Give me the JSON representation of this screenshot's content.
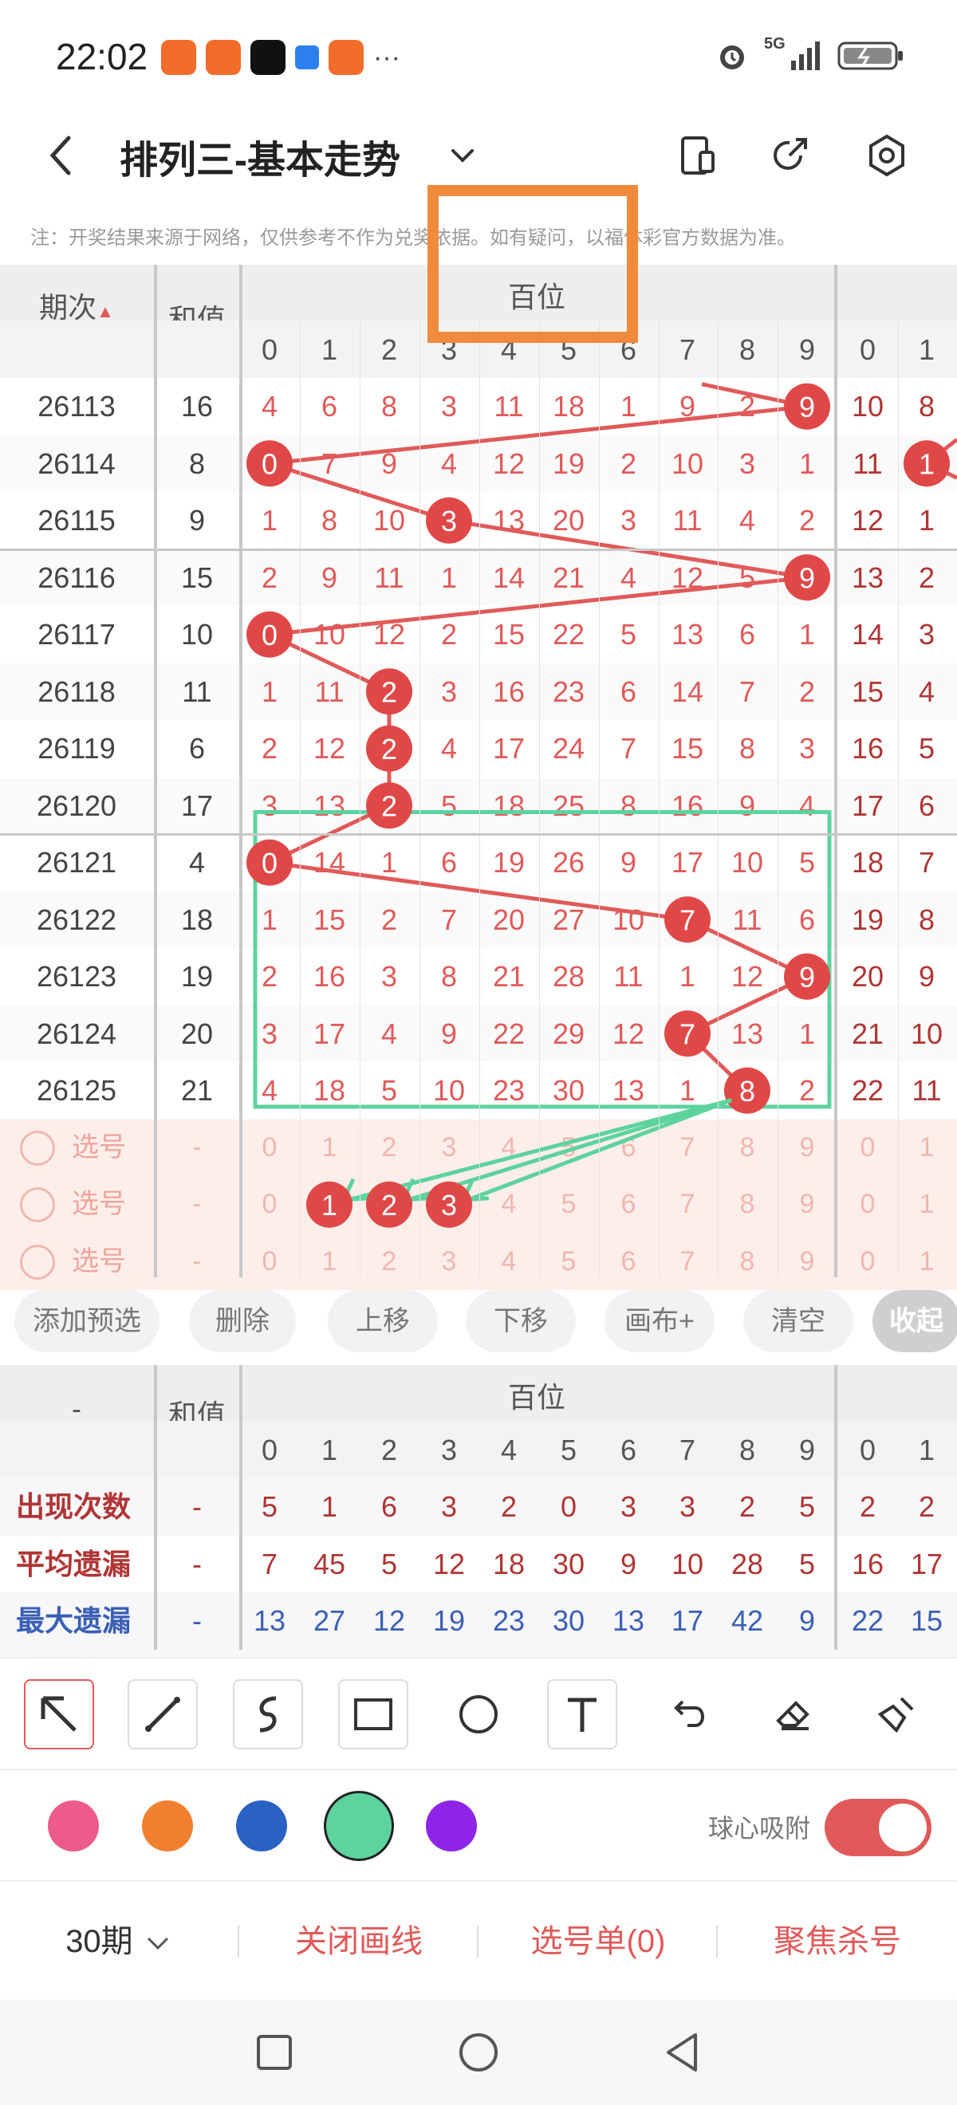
{
  "status_bar": {
    "time": "22:02",
    "dots": "···",
    "network": "5G"
  },
  "header": {
    "title": "排列三-基本走势"
  },
  "notice": "注：开奖结果来源于网络，仅供参考不作为兑奖依据。如有疑问，以福体彩官方数据为准。",
  "grid": {
    "col_period": "期次",
    "col_sum": "和值",
    "group_label": "百位",
    "digits": [
      "0",
      "1",
      "2",
      "3",
      "4",
      "5",
      "6",
      "7",
      "8",
      "9",
      "0",
      "1"
    ],
    "rows": [
      {
        "period": "26113",
        "sum": "16",
        "cells": [
          "4",
          "6",
          "8",
          "3",
          "11",
          "18",
          "1",
          "9",
          "2",
          "9",
          "10",
          "8"
        ]
      },
      {
        "period": "26114",
        "sum": "8",
        "cells": [
          "0",
          "7",
          "9",
          "4",
          "12",
          "19",
          "2",
          "10",
          "3",
          "1",
          "11",
          "1"
        ]
      },
      {
        "period": "26115",
        "sum": "9",
        "cells": [
          "1",
          "8",
          "10",
          "3",
          "13",
          "20",
          "3",
          "11",
          "4",
          "2",
          "12",
          "1"
        ]
      },
      {
        "period": "26116",
        "sum": "15",
        "cells": [
          "2",
          "9",
          "11",
          "1",
          "14",
          "21",
          "4",
          "12",
          "5",
          "9",
          "13",
          "2"
        ]
      },
      {
        "period": "26117",
        "sum": "10",
        "cells": [
          "0",
          "10",
          "12",
          "2",
          "15",
          "22",
          "5",
          "13",
          "6",
          "1",
          "14",
          "3"
        ]
      },
      {
        "period": "26118",
        "sum": "11",
        "cells": [
          "1",
          "11",
          "2",
          "3",
          "16",
          "23",
          "6",
          "14",
          "7",
          "2",
          "15",
          "4"
        ]
      },
      {
        "period": "26119",
        "sum": "6",
        "cells": [
          "2",
          "12",
          "2",
          "4",
          "17",
          "24",
          "7",
          "15",
          "8",
          "3",
          "16",
          "5"
        ]
      },
      {
        "period": "26120",
        "sum": "17",
        "cells": [
          "3",
          "13",
          "2",
          "5",
          "18",
          "25",
          "8",
          "16",
          "9",
          "4",
          "17",
          "6"
        ]
      },
      {
        "period": "26121",
        "sum": "4",
        "cells": [
          "0",
          "14",
          "1",
          "6",
          "19",
          "26",
          "9",
          "17",
          "10",
          "5",
          "18",
          "7"
        ]
      },
      {
        "period": "26122",
        "sum": "18",
        "cells": [
          "1",
          "15",
          "2",
          "7",
          "20",
          "27",
          "10",
          "7",
          "11",
          "6",
          "19",
          "8"
        ]
      },
      {
        "period": "26123",
        "sum": "19",
        "cells": [
          "2",
          "16",
          "3",
          "8",
          "21",
          "28",
          "11",
          "1",
          "12",
          "9",
          "20",
          "9"
        ]
      },
      {
        "period": "26124",
        "sum": "20",
        "cells": [
          "3",
          "17",
          "4",
          "9",
          "22",
          "29",
          "12",
          "7",
          "13",
          "1",
          "21",
          "10"
        ]
      },
      {
        "period": "26125",
        "sum": "21",
        "cells": [
          "4",
          "18",
          "5",
          "10",
          "23",
          "30",
          "13",
          "1",
          "8",
          "2",
          "22",
          "11"
        ]
      }
    ],
    "ball_positions": [
      {
        "row": 0,
        "col": 9,
        "value": "9"
      },
      {
        "row": 1,
        "col": 0,
        "value": "0"
      },
      {
        "row": 1,
        "col": 11,
        "value": "1"
      },
      {
        "row": 2,
        "col": 3,
        "value": "3"
      },
      {
        "row": 3,
        "col": 9,
        "value": "9"
      },
      {
        "row": 4,
        "col": 0,
        "value": "0"
      },
      {
        "row": 5,
        "col": 2,
        "value": "2"
      },
      {
        "row": 6,
        "col": 2,
        "value": "2"
      },
      {
        "row": 7,
        "col": 2,
        "value": "2"
      },
      {
        "row": 8,
        "col": 0,
        "value": "0"
      },
      {
        "row": 9,
        "col": 7,
        "value": "7"
      },
      {
        "row": 10,
        "col": 9,
        "value": "9"
      },
      {
        "row": 11,
        "col": 7,
        "value": "7"
      },
      {
        "row": 12,
        "col": 8,
        "value": "8"
      }
    ],
    "select_rows": [
      {
        "label": "选号",
        "sum": "-",
        "cells": [
          "0",
          "1",
          "2",
          "3",
          "4",
          "5",
          "6",
          "7",
          "8",
          "9",
          "0",
          "1"
        ]
      },
      {
        "label": "选号",
        "sum": "-",
        "cells": [
          "0",
          "1",
          "2",
          "3",
          "4",
          "5",
          "6",
          "7",
          "8",
          "9",
          "0",
          "1"
        ]
      },
      {
        "label": "选号",
        "sum": "-",
        "cells": [
          "0",
          "1",
          "2",
          "3",
          "4",
          "5",
          "6",
          "7",
          "8",
          "9",
          "0",
          "1"
        ]
      }
    ]
  },
  "buttons": [
    "添加预选",
    "删除",
    "上移",
    "下移",
    "画布+",
    "清空",
    "收起"
  ],
  "stats": {
    "corner": "-",
    "col_sum": "和值",
    "group_label": "百位",
    "digits": [
      "0",
      "1",
      "2",
      "3",
      "4",
      "5",
      "6",
      "7",
      "8",
      "9",
      "0",
      "1"
    ],
    "rows": [
      {
        "label": "出现次数",
        "color": "#b03535",
        "sum": "-",
        "cells": [
          "5",
          "1",
          "6",
          "3",
          "2",
          "0",
          "3",
          "3",
          "2",
          "5",
          "2",
          "2"
        ]
      },
      {
        "label": "平均遗漏",
        "color": "#b03535",
        "sum": "-",
        "cells": [
          "7",
          "45",
          "5",
          "12",
          "18",
          "30",
          "9",
          "10",
          "28",
          "5",
          "16",
          "17"
        ]
      },
      {
        "label": "最大遗漏",
        "color": "#3a5fb5",
        "sum": "-",
        "cells": [
          "13",
          "27",
          "12",
          "19",
          "23",
          "30",
          "13",
          "17",
          "42",
          "9",
          "22",
          "15"
        ]
      }
    ]
  },
  "draw_tools": [
    "arrow-tool",
    "line-tool",
    "curve-tool",
    "rectangle-tool",
    "circle-tool",
    "text-tool",
    "undo-tool",
    "eraser-tool",
    "clear-tool"
  ],
  "colors": [
    "#ec5b8a",
    "#f08030",
    "#2a62c4",
    "#5dd39e",
    "#8e24e8"
  ],
  "snap_label": "球心吸附",
  "bottom_bar": {
    "periods": "30期",
    "close_lines": "关闭画线",
    "selection": "选号单(0)",
    "focus_kill": "聚焦杀号"
  }
}
